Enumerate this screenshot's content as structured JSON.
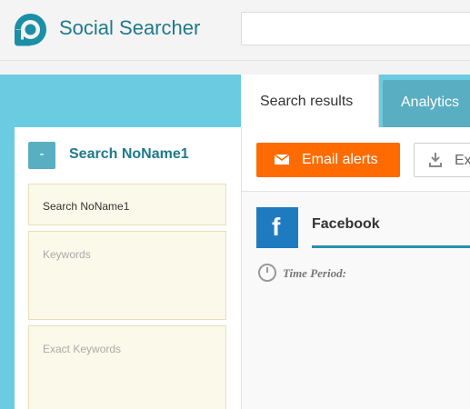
{
  "header": {
    "brand": "Social Searcher",
    "logo_icon": "ring-logo-icon",
    "search_value": ""
  },
  "tabs": [
    {
      "label": "Search results",
      "active": true
    },
    {
      "label": "Analytics",
      "active": false
    }
  ],
  "left_panel": {
    "collapse_label": "-",
    "title": "Search NoName1",
    "fields": {
      "name_value": "Search NoName1",
      "keywords_placeholder": "Keywords",
      "exact_keywords_placeholder": "Exact Keywords"
    }
  },
  "toolbar": {
    "email_alerts_label": "Email alerts",
    "export_label": "Ex",
    "email_icon": "envelope-icon",
    "export_icon": "download-icon"
  },
  "result": {
    "network": "Facebook",
    "network_icon": "facebook-icon",
    "time_period_label": "Time Period:",
    "time_icon": "clock-icon"
  },
  "colors": {
    "accent_cyan": "#6bcbe0",
    "brand_teal": "#1e7a8c",
    "tab_active_bg": "#5aaec2",
    "email_button": "#ff6b00",
    "facebook_blue": "#1f7bbf",
    "field_bg": "#fbf9e9"
  }
}
